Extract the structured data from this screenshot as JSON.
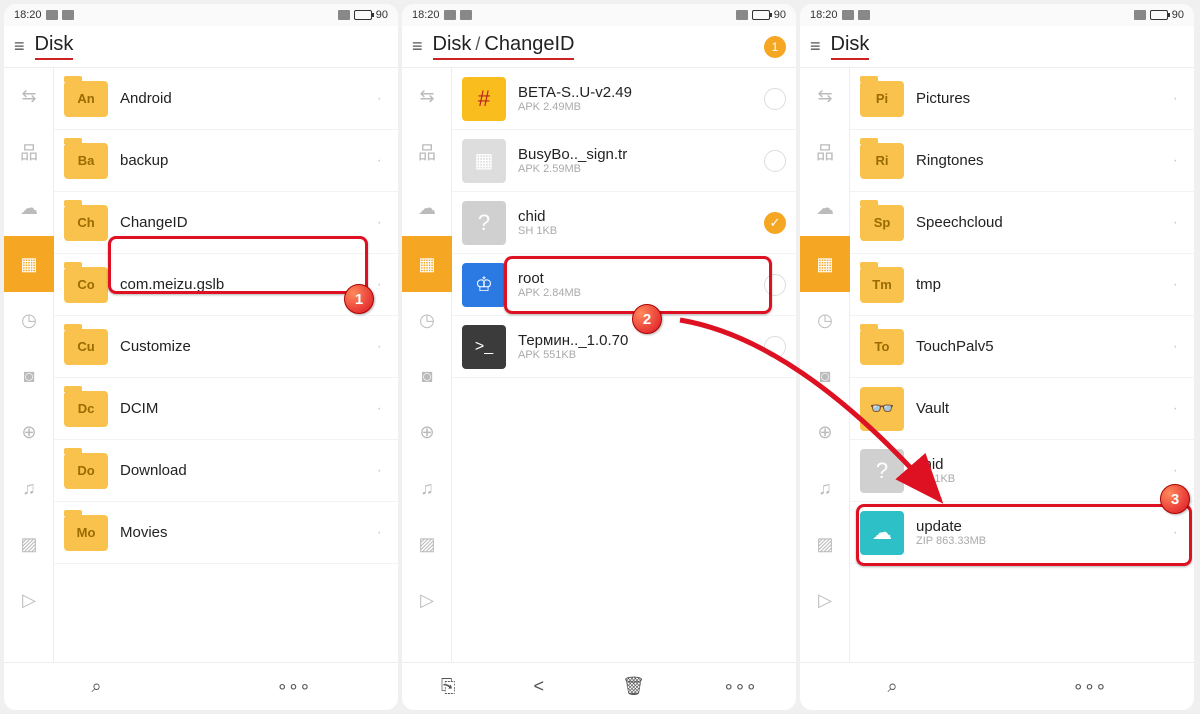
{
  "status": {
    "time": "18:20",
    "battery": "90"
  },
  "labels": {
    "disk": "Disk",
    "changeid": "ChangeID",
    "sel_count": "1"
  },
  "screen1": {
    "rows": [
      {
        "short": "An",
        "name": "Android"
      },
      {
        "short": "Ba",
        "name": "backup"
      },
      {
        "short": "Ch",
        "name": "ChangeID"
      },
      {
        "short": "Co",
        "name": "com.meizu.gslb"
      },
      {
        "short": "Cu",
        "name": "Customize"
      },
      {
        "short": "Dc",
        "name": "DCIM"
      },
      {
        "short": "Do",
        "name": "Download"
      },
      {
        "short": "Mo",
        "name": "Movies"
      }
    ]
  },
  "screen2": {
    "rows": [
      {
        "name": "BETA-S..U-v2.49",
        "sub": "APK 2.49MB"
      },
      {
        "name": "BusyBo.._sign.tr",
        "sub": "APK 2.59MB"
      },
      {
        "name": "chid",
        "sub": "SH 1KB"
      },
      {
        "name": "root",
        "sub": "APK 2.84MB"
      },
      {
        "name": "Термин.._1.0.70",
        "sub": "APK 551KB"
      }
    ]
  },
  "screen3": {
    "rows": [
      {
        "short": "Pi",
        "name": "Pictures"
      },
      {
        "short": "Ri",
        "name": "Ringtones"
      },
      {
        "short": "Sp",
        "name": "Speechcloud"
      },
      {
        "short": "Tm",
        "name": "tmp"
      },
      {
        "short": "To",
        "name": "TouchPalv5"
      },
      {
        "short": "",
        "name": "Vault"
      },
      {
        "short": "",
        "name": "chid",
        "sub": "SH 1KB"
      },
      {
        "short": "",
        "name": "update",
        "sub": "ZIP 863.33MB"
      }
    ]
  },
  "steps": {
    "1": "1",
    "2": "2",
    "3": "3"
  }
}
